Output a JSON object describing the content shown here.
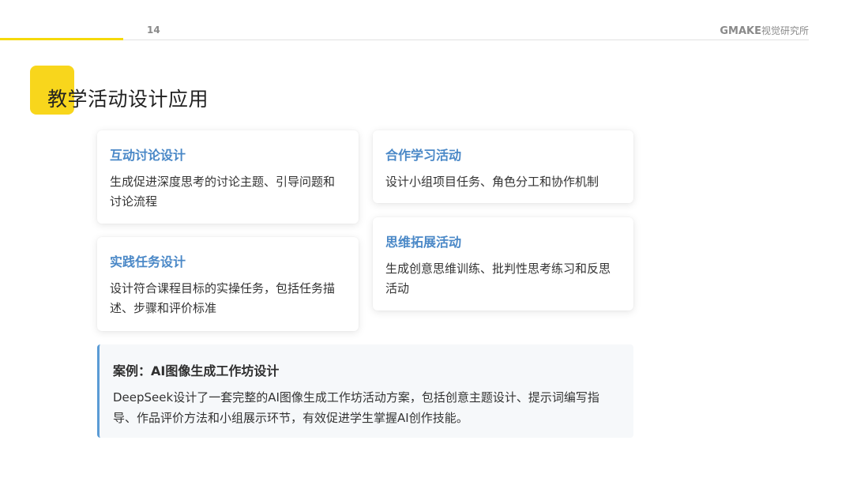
{
  "header": {
    "page_number": "14",
    "brand_en": "GMAKE",
    "brand_cn": "视觉研究所"
  },
  "title": "教学活动设计应用",
  "cards": [
    {
      "title": "互动讨论设计",
      "description": "生成促进深度思考的讨论主题、引导问题和讨论流程"
    },
    {
      "title": "实践任务设计",
      "description": "设计符合课程目标的实操任务，包括任务描述、步骤和评价标准"
    },
    {
      "title": "合作学习活动",
      "description": "设计小组项目任务、角色分工和协作机制"
    },
    {
      "title": "思维拓展活动",
      "description": "生成创意思维训练、批判性思考练习和反思活动"
    }
  ],
  "case": {
    "title": "案例：AI图像生成工作坊设计",
    "description": "DeepSeek设计了一套完整的AI图像生成工作坊活动方案，包括创意主题设计、提示词编写指导、作品评价方法和小组展示环节，有效促进学生掌握AI创作技能。"
  },
  "colors": {
    "accent_yellow": "#f8d61c",
    "card_title_blue": "#4a88c7",
    "case_border_blue": "#5b9bd5"
  }
}
